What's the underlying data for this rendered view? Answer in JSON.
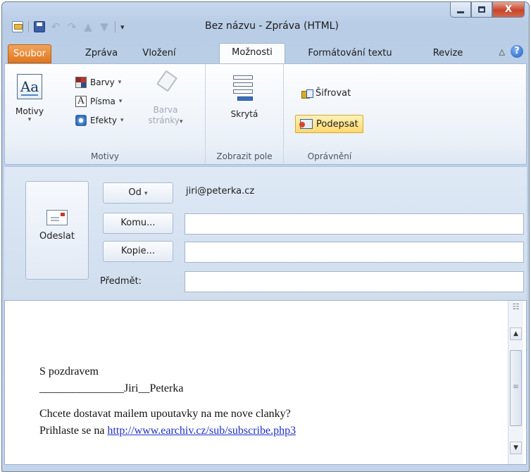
{
  "window": {
    "title": "Bez názvu - Zpráva (HTML)",
    "close_glyph": "X"
  },
  "quick_access": {
    "icons": [
      "app-icon",
      "save-icon",
      "undo-icon",
      "redo-icon",
      "up-icon",
      "down-icon"
    ],
    "undo_glyph": "↶",
    "redo_glyph": "↷",
    "up_glyph": "▲",
    "down_glyph": "▼",
    "more_glyph": "▾"
  },
  "tabs": [
    "Soubor",
    "Zpráva",
    "Vložení",
    "Možnosti",
    "Formátování textu",
    "Revize"
  ],
  "active_tab": "Možnosti",
  "ribbon": {
    "groups": {
      "motivy": "Motivy",
      "zobrazit": "Zobrazit pole",
      "opravneni": "Oprávnění"
    },
    "themes_button": "Motivy",
    "themes_glyph": "Aa",
    "colors": "Barvy",
    "fonts": "Písma",
    "fonts_glyph": "A",
    "effects": "Efekty",
    "page_color_1": "Barva",
    "page_color_2": "stránky",
    "hidden": "Skrytá",
    "encrypt": "Šifrovat",
    "sign": "Podepsat",
    "dropdown_glyph": "▾"
  },
  "compose": {
    "send": "Odeslat",
    "from_button": "Od",
    "from_value": "jiri@peterka.cz",
    "to_button": "Komu...",
    "to_value": "",
    "cc_button": "Kopie...",
    "cc_value": "",
    "subject_label": "Předmět:",
    "subject_value": ""
  },
  "body": {
    "line1": "S pozdravem",
    "line2": "_______________Jiri__Peterka",
    "line3": "Chcete dostavat mailem upoutavky na me nove clanky?",
    "line4_prefix": "Prihlaste se na ",
    "link": "http://www.earchiv.cz/sub/subscribe.php3"
  },
  "scrollbar": {
    "up": "▲",
    "down": "▼",
    "grip": "≡"
  },
  "colors": {
    "file_tab": "#e07a24",
    "highlight": "#ffd86b",
    "link": "#1f2fc7"
  }
}
